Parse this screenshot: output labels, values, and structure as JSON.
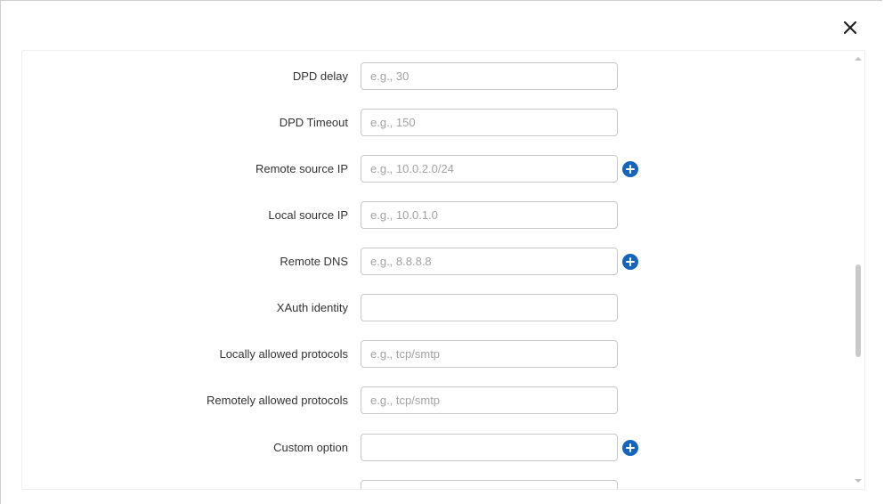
{
  "fields": [
    {
      "label": "DPD delay",
      "placeholder": "e.g., 30",
      "value": "",
      "has_add": false
    },
    {
      "label": "DPD Timeout",
      "placeholder": "e.g., 150",
      "value": "",
      "has_add": false
    },
    {
      "label": "Remote source IP",
      "placeholder": "e.g., 10.0.2.0/24",
      "value": "",
      "has_add": true
    },
    {
      "label": "Local source IP",
      "placeholder": "e.g., 10.0.1.0",
      "value": "",
      "has_add": false
    },
    {
      "label": "Remote DNS",
      "placeholder": "e.g., 8.8.8.8",
      "value": "",
      "has_add": true
    },
    {
      "label": "XAuth identity",
      "placeholder": "",
      "value": "",
      "has_add": false
    },
    {
      "label": "Locally allowed protocols",
      "placeholder": "e.g., tcp/smtp",
      "value": "",
      "has_add": false
    },
    {
      "label": "Remotely allowed protocols",
      "placeholder": "e.g., tcp/smtp",
      "value": "",
      "has_add": false
    },
    {
      "label": "Custom option",
      "placeholder": "",
      "value": "",
      "has_add": true
    },
    {
      "label": "",
      "placeholder": "",
      "value": "",
      "has_add": false
    }
  ],
  "icons": {
    "close": "close-icon",
    "add": "plus-circle-icon"
  },
  "colors": {
    "accent": "#1565c0",
    "label": "#333333",
    "placeholder": "#a3a3a3",
    "border": "#c8c8c8"
  }
}
